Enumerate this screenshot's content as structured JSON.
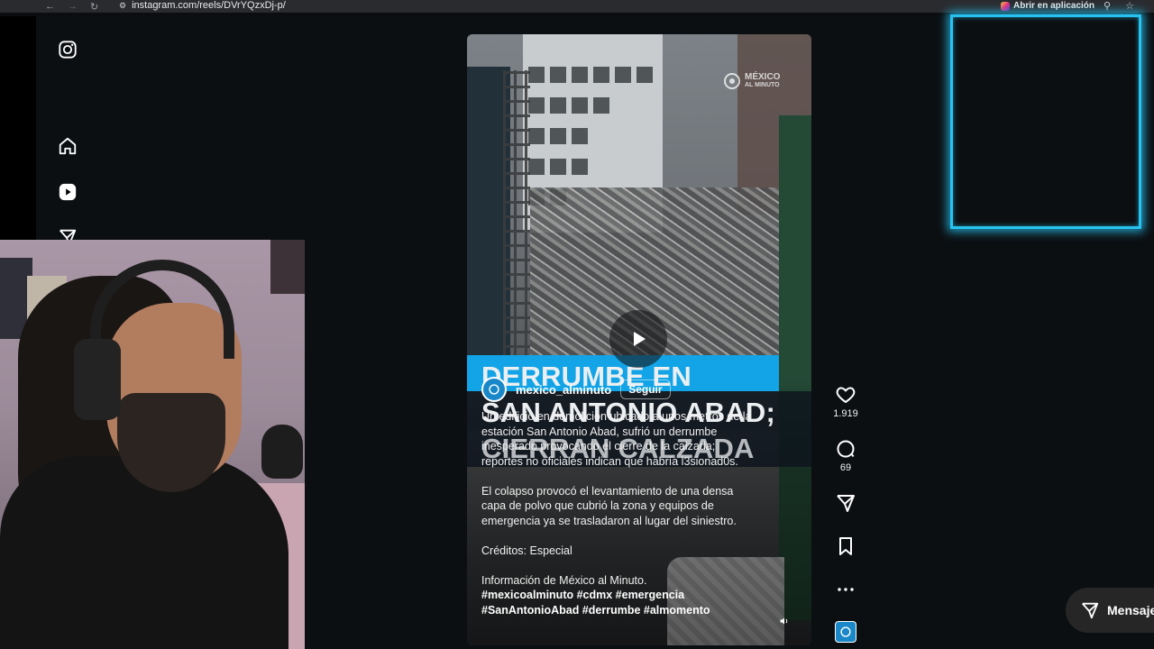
{
  "browser": {
    "url": "instagram.com/reels/DVrYQzxDj-p/",
    "open_in_app": "Abrir en aplicación"
  },
  "sidebar": {
    "icons": [
      "instagram-logo-icon",
      "home-icon",
      "reels-icon",
      "send-icon"
    ]
  },
  "reel": {
    "watermark_line1": "MÉXICO",
    "watermark_line2": "AL MINUTO",
    "headline": [
      "DERRUMBE EN",
      "SAN ANTONIO ABAD;",
      "CIERRAN CALZADA"
    ],
    "author": "mexico_alminuto",
    "follow_label": "Seguir",
    "caption_p1": "Un edificio en demolición ubicado a unos metros de la estación San Antonio Abad, sufrió un derrumbe inesperado provocando el cierre de la calzada; reportes no oficiales indican que habría l3sionad0s.",
    "caption_p2": "El colapso provocó el levantamiento de una densa capa de polvo que cubrió la zona y equipos de emergencia ya se trasladaron al lugar del siniestro.",
    "caption_p3": "Créditos: Especial",
    "caption_p4": "Información de México al Minuto.",
    "hashtags_line1": "#mexicoalminuto #cdmx #emergencia",
    "hashtags_line2": "#SanAntonioAbad #derrumbe #almomento"
  },
  "actions": {
    "likes": "1.919",
    "comments": "69"
  },
  "messages": {
    "label": "Mensajes"
  },
  "colors": {
    "accent_headline": "#12a4e6",
    "cam_frame": "#27c2f0"
  }
}
